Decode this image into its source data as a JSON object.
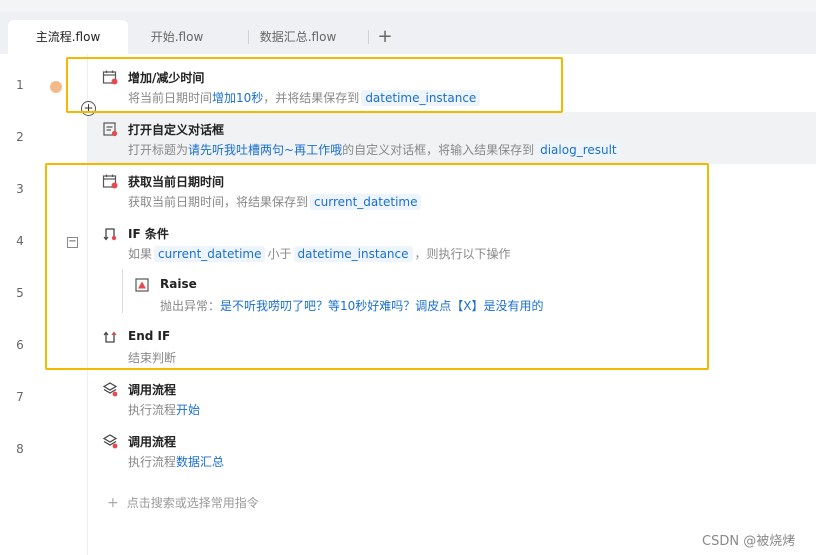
{
  "tabs": [
    {
      "label": "主流程.flow",
      "active": true
    },
    {
      "label": "开始.flow",
      "active": false
    },
    {
      "label": "数据汇总.flow",
      "active": false
    }
  ],
  "tab_add_label": "+",
  "rows": [
    {
      "line": "1",
      "icon": "calendar-icon",
      "title": "增加/减少时间",
      "desc": {
        "text1": "将当前日期时间",
        "link1": "增加10秒",
        "text2": "，并将结果保存到",
        "var1": "datetime_instance"
      }
    },
    {
      "line": "2",
      "icon": "dialog-icon",
      "title": "打开自定义对话框",
      "desc": {
        "text1": "打开标题为",
        "link1": "请先听我吐槽两句~再工作哦",
        "text2": "的自定义对话框，将输入结果保存到",
        "var1": "dialog_result"
      }
    },
    {
      "line": "3",
      "icon": "calendar-icon",
      "title": "获取当前日期时间",
      "desc": {
        "text1": "获取当前日期时间，将结果保存到",
        "var1": "current_datetime"
      }
    },
    {
      "line": "4",
      "icon": "if-branch-icon",
      "title": "IF 条件",
      "desc": {
        "text1": "如果",
        "var1": "current_datetime",
        "text2": "小于",
        "var2": "datetime_instance",
        "text3": "，则执行以下操作"
      }
    },
    {
      "line": "5",
      "icon": "warning-icon",
      "title": "Raise",
      "desc": {
        "text1": "抛出异常：",
        "link1": "是不听我唠叨了吧？等10秒好难吗？调皮点【X】是没有用的"
      }
    },
    {
      "line": "6",
      "icon": "end-if-icon",
      "title": "End IF",
      "desc": {
        "text1": "结束判断"
      }
    },
    {
      "line": "7",
      "icon": "layers-icon",
      "title": "调用流程",
      "desc": {
        "text1": "执行流程",
        "link1": "开始"
      }
    },
    {
      "line": "8",
      "icon": "layers-icon",
      "title": "调用流程",
      "desc": {
        "text1": "执行流程",
        "link1": "数据汇总"
      }
    }
  ],
  "add_hint": "点击搜索或选择常用指令",
  "add_hint_plus": "+",
  "watermark": "CSDN @被烧烤",
  "colors": {
    "accent": "#1a6fd1",
    "selection": "#f3b800",
    "breakpoint": "#f4b98b",
    "icon_red": "#e8484f"
  }
}
